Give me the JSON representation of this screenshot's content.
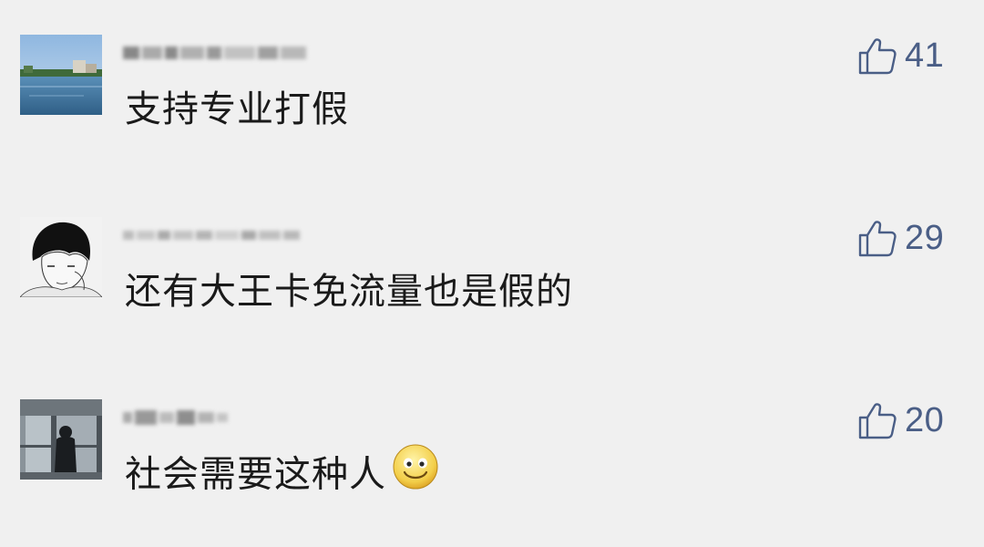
{
  "comments": [
    {
      "avatar": "river-landscape-avatar",
      "text": "支持专业打假",
      "likes": "41",
      "emoji": ""
    },
    {
      "avatar": "sketch-boy-avatar",
      "text": "还有大王卡免流量也是假的",
      "likes": "29",
      "emoji": ""
    },
    {
      "avatar": "silhouette-window-avatar",
      "text": "社会需要这种人",
      "likes": "20",
      "emoji": "smile-emoji"
    }
  ],
  "colors": {
    "background": "#f0f0f0",
    "text": "#1a1a1a",
    "like_accent": "#4a5e86"
  }
}
